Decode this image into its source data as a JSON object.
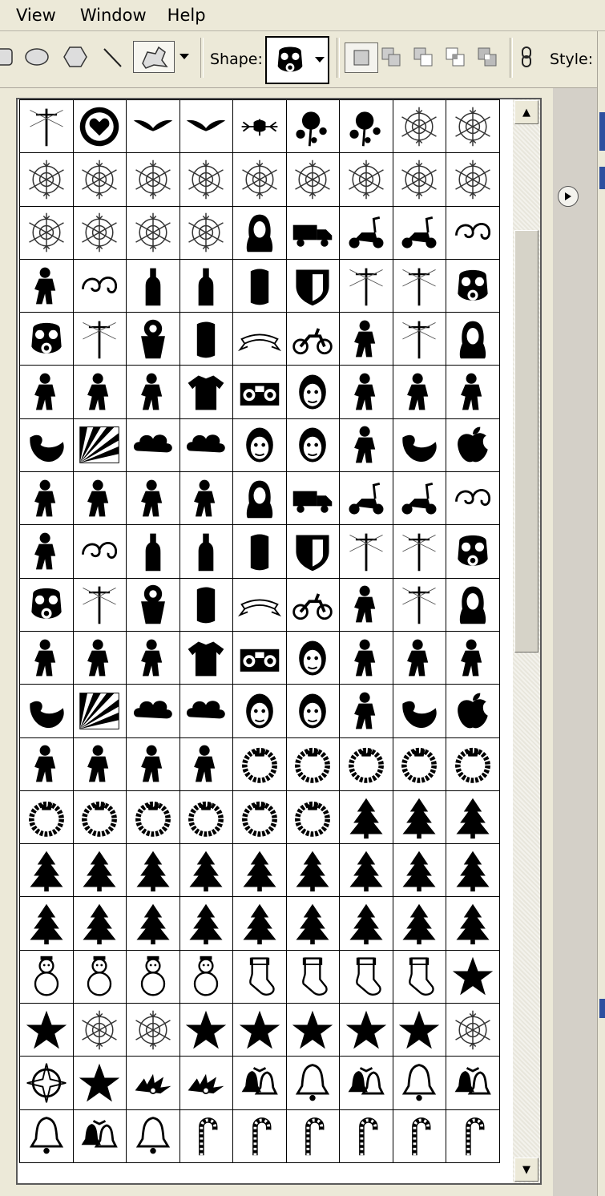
{
  "menubar": {
    "items": [
      "View",
      "Window",
      "Help"
    ]
  },
  "options_bar": {
    "shape_label": "Shape:",
    "style_label": "Style:",
    "tools": [
      "rectangle-tool",
      "ellipse-tool",
      "polygon-tool",
      "line-tool",
      "custom-shape-tool"
    ],
    "combine_modes": [
      "new-shape-area",
      "add-to-shape-area",
      "subtract-from-shape-area",
      "intersect-shape-areas",
      "exclude-overlapping-areas"
    ],
    "selected_shape_icon": "gas-mask-icon"
  },
  "shape_picker": {
    "menu_icon": "panel-menu-arrow-icon",
    "columns": 9,
    "rows": [
      [
        "pole",
        "heart-circle",
        "wings",
        "wings",
        "ornament",
        "splat",
        "splat",
        "snowflake",
        "snowflake"
      ],
      [
        "snowflake",
        "snowflake",
        "snowflake",
        "snowflake",
        "snowflake",
        "snowflake",
        "snowflake",
        "snowflake",
        "snowflake"
      ],
      [
        "snowflake",
        "snowflake",
        "snowflake",
        "snowflake",
        "portrait",
        "truck",
        "scooter",
        "scooter",
        "swirl"
      ],
      [
        "figure",
        "swirl",
        "bottle",
        "bottle",
        "can",
        "shield",
        "pole",
        "pole",
        "gas-mask"
      ],
      [
        "gas-mask",
        "pole",
        "bucket",
        "can",
        "ribbon",
        "motorbike",
        "figure",
        "pole",
        "portrait"
      ],
      [
        "figure",
        "figure",
        "figure",
        "shirt",
        "boombox",
        "face",
        "figure",
        "figure",
        "figure"
      ],
      [
        "blob",
        "sunburst",
        "cloud",
        "cloud",
        "face",
        "face",
        "figure",
        "blob",
        "apple"
      ],
      [
        "figure",
        "figure",
        "figure",
        "figure",
        "portrait",
        "truck",
        "scooter",
        "scooter",
        "swirl"
      ],
      [
        "figure",
        "swirl",
        "bottle",
        "bottle",
        "can",
        "shield",
        "pole",
        "pole",
        "gas-mask"
      ],
      [
        "gas-mask",
        "pole",
        "bucket",
        "can",
        "ribbon",
        "motorbike",
        "figure",
        "pole",
        "portrait"
      ],
      [
        "figure",
        "figure",
        "figure",
        "shirt",
        "boombox",
        "face",
        "figure",
        "figure",
        "figure"
      ],
      [
        "blob",
        "sunburst",
        "cloud",
        "cloud",
        "face",
        "face",
        "figure",
        "blob",
        "apple"
      ],
      [
        "figure",
        "figure",
        "figure",
        "figure",
        "wreath",
        "wreath",
        "wreath",
        "wreath",
        "wreath"
      ],
      [
        "wreath",
        "wreath",
        "wreath",
        "wreath",
        "wreath",
        "wreath",
        "tree",
        "tree",
        "tree"
      ],
      [
        "tree",
        "tree",
        "tree",
        "tree",
        "tree",
        "tree",
        "tree",
        "tree",
        "tree"
      ],
      [
        "tree",
        "tree",
        "tree",
        "tree",
        "tree",
        "tree",
        "tree",
        "tree",
        "tree"
      ],
      [
        "snowman",
        "snowman",
        "snowman",
        "snowman",
        "stocking",
        "stocking",
        "stocking",
        "stocking",
        "star"
      ],
      [
        "star",
        "snowflake",
        "snowflake",
        "star",
        "star",
        "star",
        "star",
        "star",
        "snowflake"
      ],
      [
        "compass",
        "star",
        "holly",
        "holly",
        "bells",
        "bell",
        "bells",
        "bell",
        "bells"
      ],
      [
        "bell",
        "bells",
        "bell",
        "candy-cane",
        "candy-cane",
        "candy-cane",
        "candy-cane",
        "candy-cane",
        "candy-cane"
      ]
    ]
  }
}
